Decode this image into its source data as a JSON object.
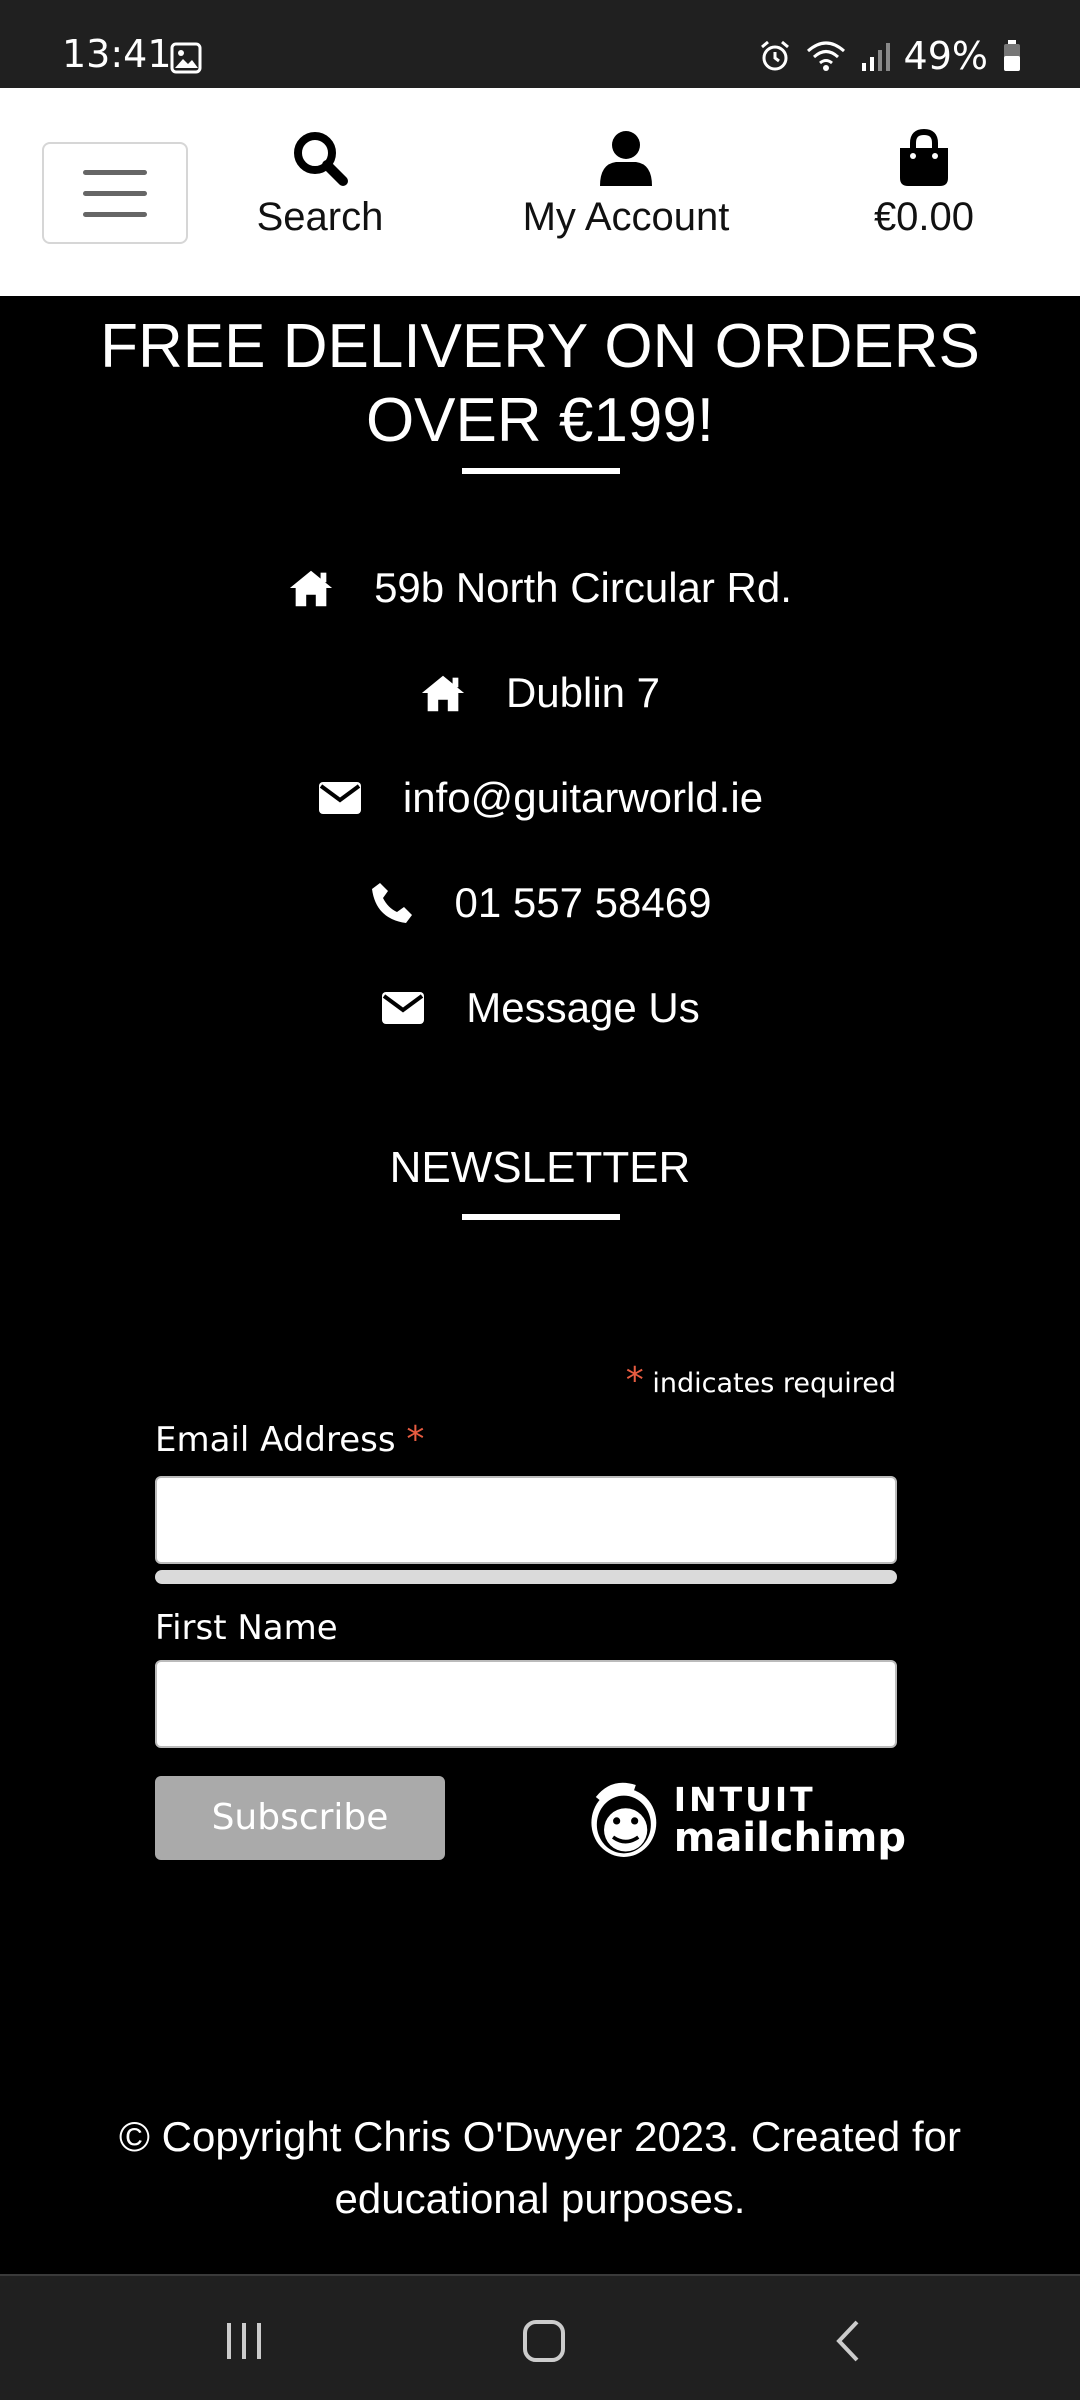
{
  "status_bar": {
    "time": "13:41",
    "battery": "49%",
    "icons": [
      "image-icon",
      "alarm-icon",
      "wifi-icon",
      "signal-icon",
      "battery-icon"
    ]
  },
  "header": {
    "search_label": "Search",
    "account_label": "My Account",
    "cart_total": "€0.00",
    "icons": [
      "menu-icon",
      "search-icon",
      "user-icon",
      "shopping-bag-icon"
    ]
  },
  "footer": {
    "delivery_line1": "FREE DELIVERY ON ORDERS",
    "delivery_line2": "OVER €199!",
    "contacts": {
      "address_line1": "59b North Circular Rd.",
      "address_line2": "Dublin 7",
      "email": "info@guitarworld.ie",
      "phone": "01 557 58469",
      "message": "Message Us"
    },
    "contact_icons": [
      "home-icon",
      "home-icon",
      "envelope-icon",
      "phone-icon",
      "envelope-icon"
    ],
    "newsletter_title": "NEWSLETTER"
  },
  "form": {
    "required_star": "*",
    "required_note": "indicates required",
    "email_label": "Email Address",
    "email_value": "",
    "first_name_label": "First Name",
    "first_name_value": "",
    "subscribe_label": "Subscribe",
    "brand_top": "INTUIT",
    "brand_bottom": "mailchimp"
  },
  "copyright": {
    "line1": "© Copyright Chris O'Dwyer 2023. Created for",
    "line2": "educational purposes."
  },
  "nav_bar": {
    "icons": [
      "recent-apps-icon",
      "home-icon",
      "back-icon"
    ]
  },
  "colors": {
    "background": "#000000",
    "header_bg": "#ffffff",
    "system_bar": "#202020",
    "required_star": "#e85c41",
    "subscribe_bg": "#aaaaaa"
  }
}
